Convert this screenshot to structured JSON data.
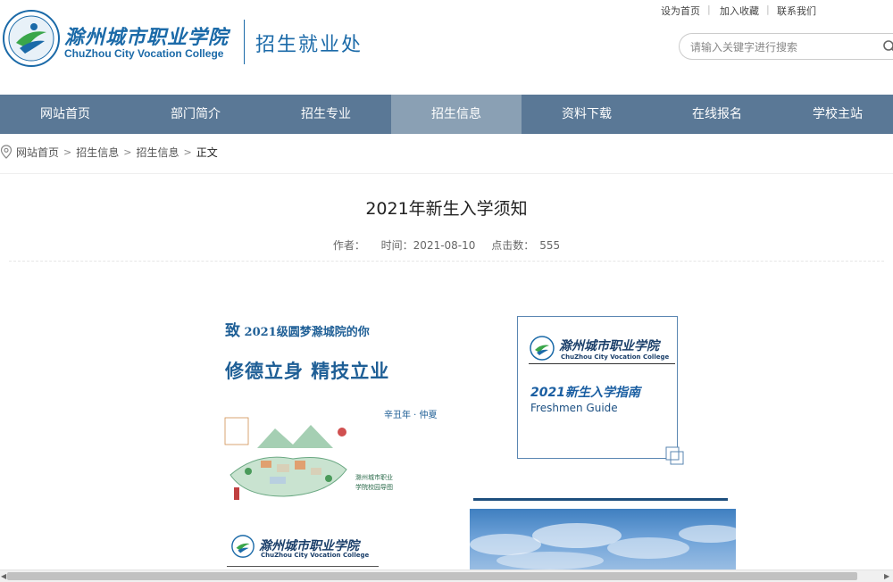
{
  "header": {
    "college_name_cn": "滁州城市职业学院",
    "college_name_en": "ChuZhou City Vocation College",
    "dept_title": "招生就业处",
    "top_links": [
      "设为首页",
      "加入收藏",
      "联系我们"
    ],
    "search": {
      "placeholder": "请输入关键字进行搜索",
      "value": ""
    }
  },
  "nav": {
    "items": [
      "网站首页",
      "部门简介",
      "招生专业",
      "招生信息",
      "资料下载",
      "在线报名",
      "学校主站"
    ],
    "active_index": 3
  },
  "breadcrumb": {
    "items": [
      "网站首页",
      "招生信息",
      "招生信息"
    ],
    "current": "正文"
  },
  "article": {
    "title": "2021年新生入学须知",
    "author_label": "作者：",
    "author": "",
    "time_label": "时间：",
    "time": "2021-08-10",
    "views_label": "点击数：",
    "views": "555"
  },
  "poster": {
    "greeting_prefix": "致",
    "greeting": "2021级圆梦滁城院的你",
    "motto": "修德立身 精技立业",
    "date_text": "辛丑年 · 仲夏",
    "map_caption_line1": "滁州城市职业",
    "map_caption_line2": "学院校园导图",
    "logo_cn": "滁州城市职业学院",
    "logo_en": "ChuZhou City Vocation College",
    "guide_cn": "2021新生入学指南",
    "guide_en": "Freshmen Guide"
  },
  "colors": {
    "brand_blue": "#1b6aa8",
    "nav_bg": "#5a7896",
    "nav_active": "#8aa0b4"
  }
}
